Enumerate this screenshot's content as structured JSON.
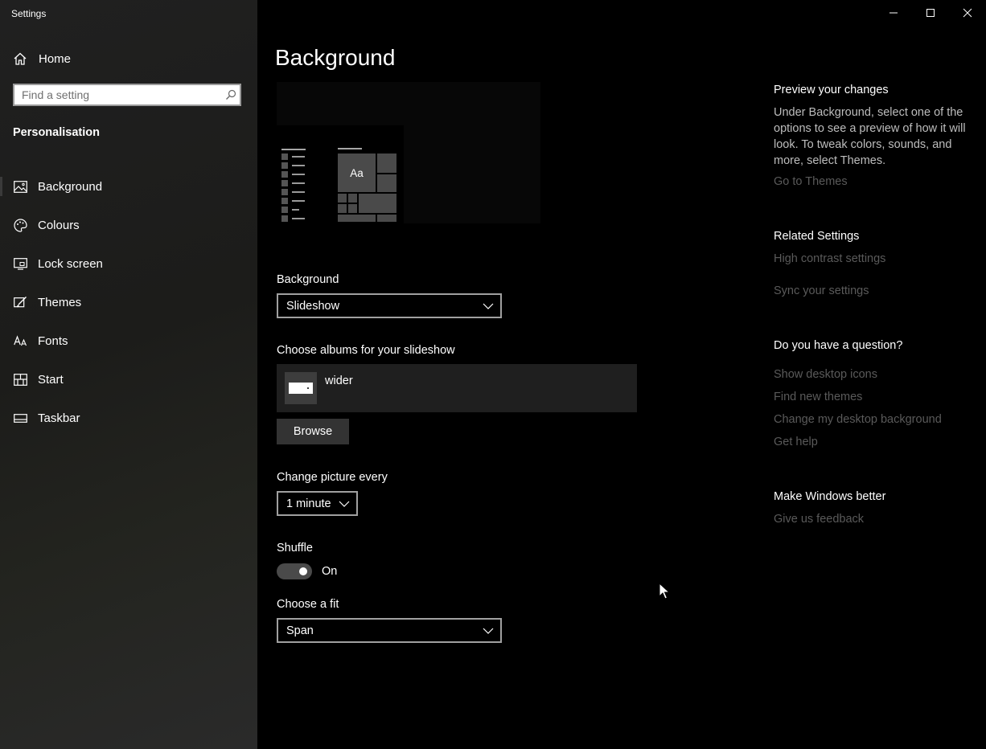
{
  "window": {
    "title": "Settings",
    "controls": {
      "minimize": "minimize-icon",
      "maximize": "maximize-icon",
      "close": "close-icon"
    }
  },
  "sidebar": {
    "home_label": "Home",
    "search_placeholder": "Find a setting",
    "section_title": "Personalisation",
    "items": [
      {
        "label": "Background",
        "icon": "picture-icon",
        "active": true
      },
      {
        "label": "Colours",
        "icon": "palette-icon"
      },
      {
        "label": "Lock screen",
        "icon": "lock-screen-icon"
      },
      {
        "label": "Themes",
        "icon": "brush-icon"
      },
      {
        "label": "Fonts",
        "icon": "fonts-icon"
      },
      {
        "label": "Start",
        "icon": "start-icon"
      },
      {
        "label": "Taskbar",
        "icon": "taskbar-icon"
      }
    ]
  },
  "main": {
    "title": "Background",
    "preview": {
      "tile_text": "Aa"
    },
    "background": {
      "label": "Background",
      "value": "Slideshow"
    },
    "albums": {
      "label": "Choose albums for your slideshow",
      "album_name": "wider"
    },
    "browse_label": "Browse",
    "interval": {
      "label": "Change picture every",
      "value": "1 minute"
    },
    "shuffle": {
      "label": "Shuffle",
      "state": "On",
      "on": true
    },
    "fit": {
      "label": "Choose a fit",
      "value": "Span"
    }
  },
  "right_panel": {
    "preview_heading": "Preview your changes",
    "preview_text": "Under Background, select one of the options to see a preview of how it will look. To tweak colors, sounds, and more, select Themes.",
    "go_to_themes": "Go to Themes",
    "related_heading": "Related Settings",
    "related_links": [
      "High contrast settings",
      "Sync your settings"
    ],
    "question_heading": "Do you have a question?",
    "question_links": [
      "Show desktop icons",
      "Find new themes",
      "Change my desktop background",
      "Get help"
    ],
    "better_heading": "Make Windows better",
    "feedback_link": "Give us feedback"
  },
  "colors": {
    "accent_link": "#5a5a5a",
    "sidebar_bg": "#1f1f1f",
    "main_bg": "#000000"
  }
}
